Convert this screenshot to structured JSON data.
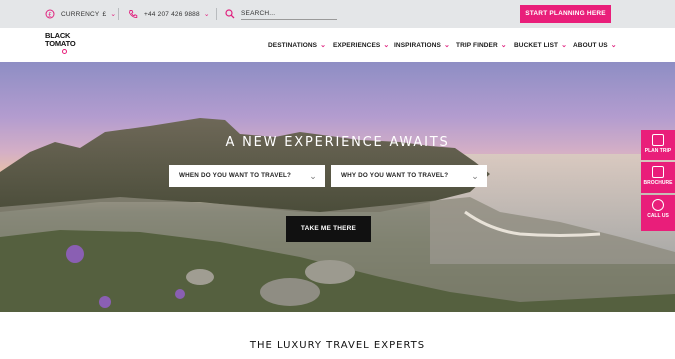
{
  "topbar": {
    "currency_label": "CURRENCY",
    "currency_value": "£",
    "phone": "+44 207 426 9888",
    "search_placeholder": "SEARCH...",
    "cta": "START PLANNING HERE"
  },
  "nav": {
    "logo_text": "BLACK TOMATO",
    "items": [
      {
        "label": "DESTINATIONS"
      },
      {
        "label": "EXPERIENCES"
      },
      {
        "label": "INSPIRATIONS"
      },
      {
        "label": "TRIP FINDER"
      },
      {
        "label": "BUCKET LIST"
      },
      {
        "label": "ABOUT US"
      }
    ]
  },
  "hero": {
    "headline": "A NEW EXPERIENCE AWAITS",
    "when_select": "WHEN DO YOU WANT TO TRAVEL?",
    "why_select": "WHY DO YOU WANT TO TRAVEL?",
    "submit": "TAKE ME THERE"
  },
  "side_tabs": [
    {
      "label": "PLAN TRIP",
      "icon": "edit-icon"
    },
    {
      "label": "BROCHURE",
      "icon": "book-icon"
    },
    {
      "label": "CALL US",
      "icon": "phone-icon"
    }
  ],
  "section": {
    "title": "THE LUXURY TRAVEL EXPERTS"
  },
  "colors": {
    "accent": "#e91e7a",
    "topbar_bg": "#e4e6e8",
    "button_dark": "#111111"
  }
}
